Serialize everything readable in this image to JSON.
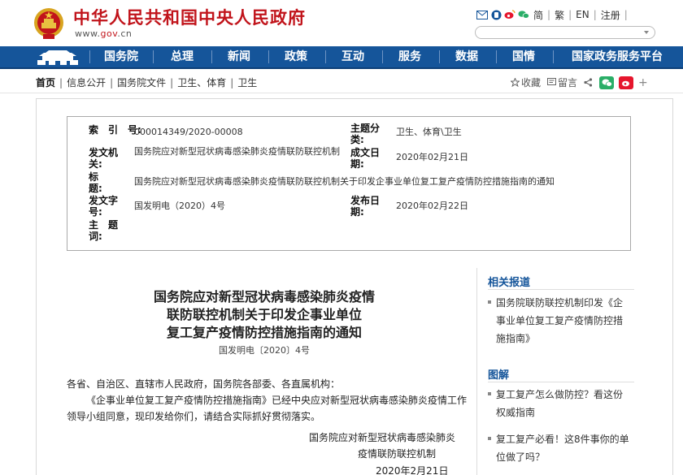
{
  "header": {
    "title": "中华人民共和国中央人民政府",
    "url_prefix": "www.",
    "url_brand": "gov",
    "url_suffix": ".cn",
    "tools": {
      "simplified": "简",
      "traditional": "繁",
      "english": "EN",
      "register": "注册"
    },
    "search_placeholder": ""
  },
  "nav": {
    "items": [
      "国务院",
      "总理",
      "新闻",
      "政策",
      "互动",
      "服务",
      "数据",
      "国情",
      "国家政务服务平台"
    ]
  },
  "breadcrumb": {
    "home": "首页",
    "items": [
      "信息公开",
      "国务院文件",
      "卫生、体育",
      "卫生"
    ],
    "separator": "|"
  },
  "page_tools": {
    "favorite": "收藏",
    "comment": "留言"
  },
  "meta": {
    "index_label": "索　引　号:",
    "index_value": "000014349/2020-00008",
    "topic_label": "主题分类:",
    "topic_value": "卫生、体育\\卫生",
    "issuer_label": "发文机关:",
    "issuer_value": "国务院应对新型冠状病毒感染肺炎疫情联防联控机制",
    "created_label": "成文日期:",
    "created_value": "2020年02月21日",
    "title_label": "标　　题:",
    "title_value": "国务院应对新型冠状病毒感染肺炎疫情联防联控机制关于印发企事业单位复工复产疫情防控措施指南的通知",
    "docno_label": "发文字号:",
    "docno_value": "国发明电（2020）4号",
    "published_label": "发布日期:",
    "published_value": "2020年02月22日",
    "keywords_label": "主　题　词:",
    "keywords_value": ""
  },
  "article": {
    "title_lines": [
      "国务院应对新型冠状病毒感染肺炎疫情",
      "联防联控机制关于印发企事业单位",
      "复工复产疫情防控措施指南的通知"
    ],
    "doc_number": "国发明电〔2020〕4号",
    "salutation": "各省、自治区、直辖市人民政府，国务院各部委、各直属机构：",
    "body": "《企事业单位复工复产疫情防控措施指南》已经中央应对新型冠状病毒感染肺炎疫情工作领导小组同意，现印发给你们，请结合实际抓好贯彻落实。",
    "signature_line1": "国务院应对新型冠状病毒感染肺炎",
    "signature_line2": "疫情联防联控机制",
    "date": "2020年2月21日"
  },
  "sidebar": {
    "related_heading": "相关报道",
    "related_items": [
      "国务院联防联控机制印发《企事业单位复工复产疫情防控措施指南》"
    ],
    "graphics_heading": "图解",
    "graphics_items": [
      "复工复产怎么做防控？看这份权威指南",
      "复工复产必看！这8件事你的单位做了吗？"
    ]
  },
  "colors": {
    "brand_red": "#c1141b",
    "nav_blue": "#15559a",
    "wechat_green": "#2aae67",
    "weibo_red": "#e6162d"
  }
}
